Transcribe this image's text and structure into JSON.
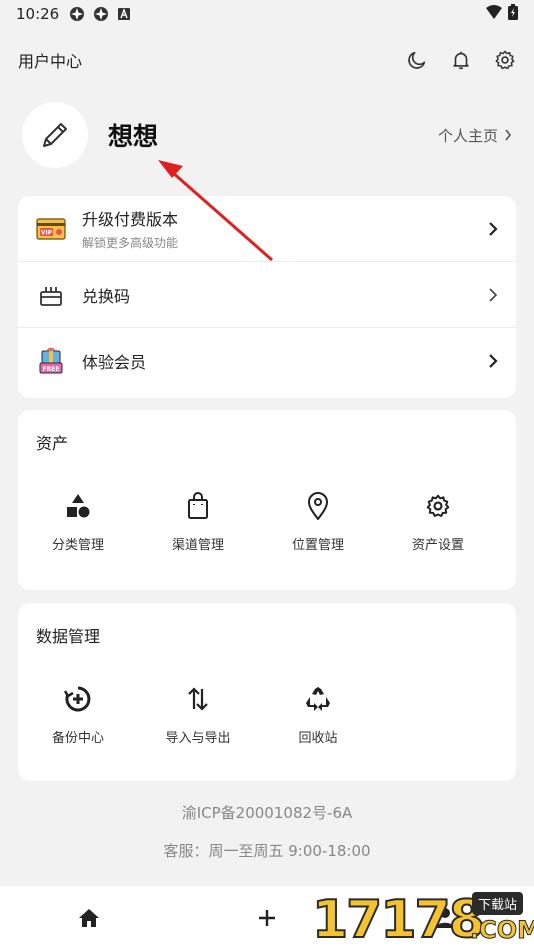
{
  "status_bar": {
    "time": "10:26"
  },
  "header": {
    "title": "用户中心"
  },
  "profile": {
    "name": "想想",
    "home_link": "个人主页"
  },
  "menu": [
    {
      "label": "升级付费版本",
      "sub": "解锁更多高级功能",
      "icon": "vip-card-icon"
    },
    {
      "label": "兑换码",
      "sub": "",
      "icon": "gift-box-icon"
    },
    {
      "label": "体验会员",
      "sub": "",
      "icon": "free-gift-icon"
    }
  ],
  "assets": {
    "title": "资产",
    "items": [
      {
        "label": "分类管理",
        "icon": "shapes-icon"
      },
      {
        "label": "渠道管理",
        "icon": "shopping-bag-icon"
      },
      {
        "label": "位置管理",
        "icon": "location-pin-icon"
      },
      {
        "label": "资产设置",
        "icon": "gear-icon"
      }
    ]
  },
  "data_mgmt": {
    "title": "数据管理",
    "items": [
      {
        "label": "备份中心",
        "icon": "backup-icon"
      },
      {
        "label": "导入与导出",
        "icon": "import-export-icon"
      },
      {
        "label": "回收站",
        "icon": "recycle-icon"
      }
    ]
  },
  "footer": {
    "icp": "渝ICP备20001082号-6A",
    "service": "客服：周一至周五 9:00-18:00"
  },
  "watermark": {
    "number": "17178",
    "tag": "下载站",
    "domain": ".COM"
  },
  "colors": {
    "accent_arrow": "#e02020",
    "background": "#f2f2f2",
    "card": "#ffffff"
  }
}
